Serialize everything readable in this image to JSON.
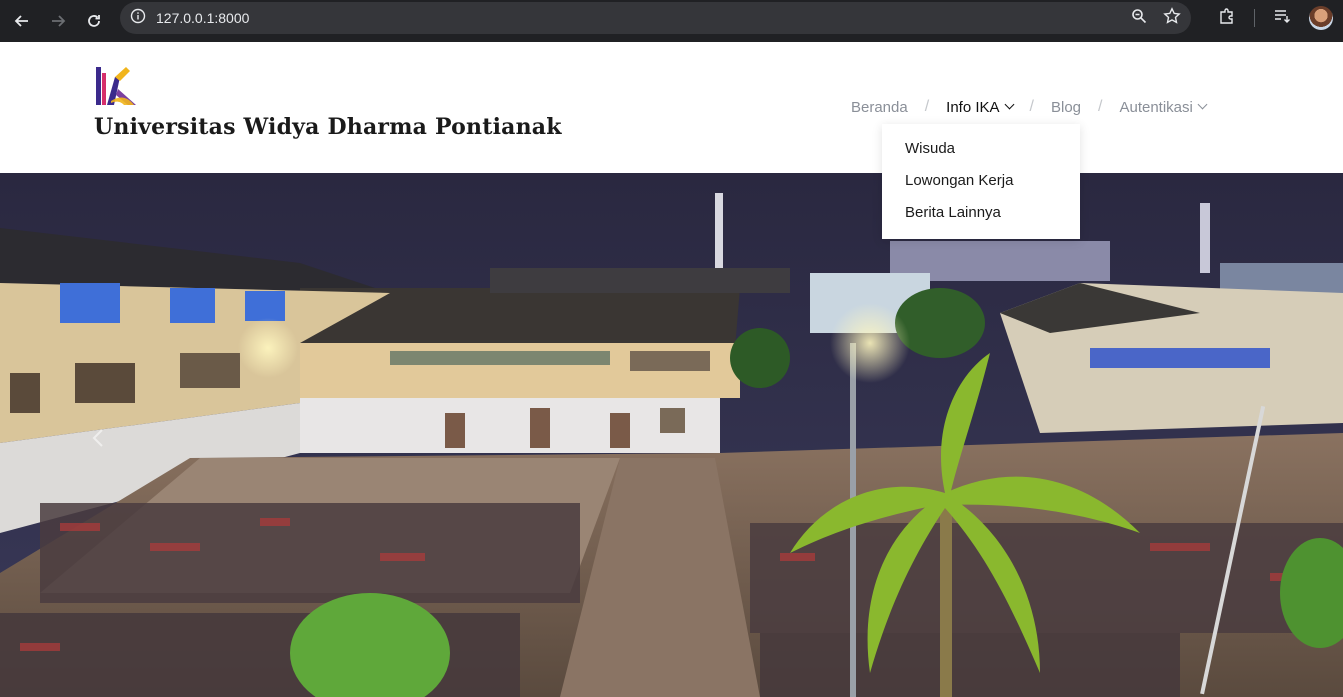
{
  "browser": {
    "url": "127.0.0.1:8000",
    "icons": [
      "back-icon",
      "forward-icon",
      "reload-icon",
      "site-info-icon",
      "zoom-icon",
      "bookmark-star-icon",
      "extensions-icon",
      "reading-list-icon",
      "profile-avatar"
    ]
  },
  "site": {
    "title": "Universitas Widya Dharma Pontianak",
    "logo_text": "IKA"
  },
  "nav": {
    "items": [
      {
        "label": "Beranda",
        "has_dropdown": false,
        "active": false
      },
      {
        "label": "Info IKA",
        "has_dropdown": true,
        "active": true
      },
      {
        "label": "Blog",
        "has_dropdown": false,
        "active": false
      },
      {
        "label": "Autentikasi",
        "has_dropdown": true,
        "active": false
      }
    ],
    "separator": "/",
    "dropdown": {
      "parent": "Info IKA",
      "items": [
        "Wisuda",
        "Lowongan Kerja",
        "Berita Lainnya"
      ]
    }
  },
  "hero": {
    "description": "campus-night-photo",
    "controls": [
      "carousel-prev-icon"
    ]
  },
  "colors": {
    "chrome_bg": "#202124",
    "omnibox_bg": "#35363a",
    "menu_inactive": "#8a8f98",
    "menu_active": "#111111",
    "title": "#1a1a1a"
  }
}
